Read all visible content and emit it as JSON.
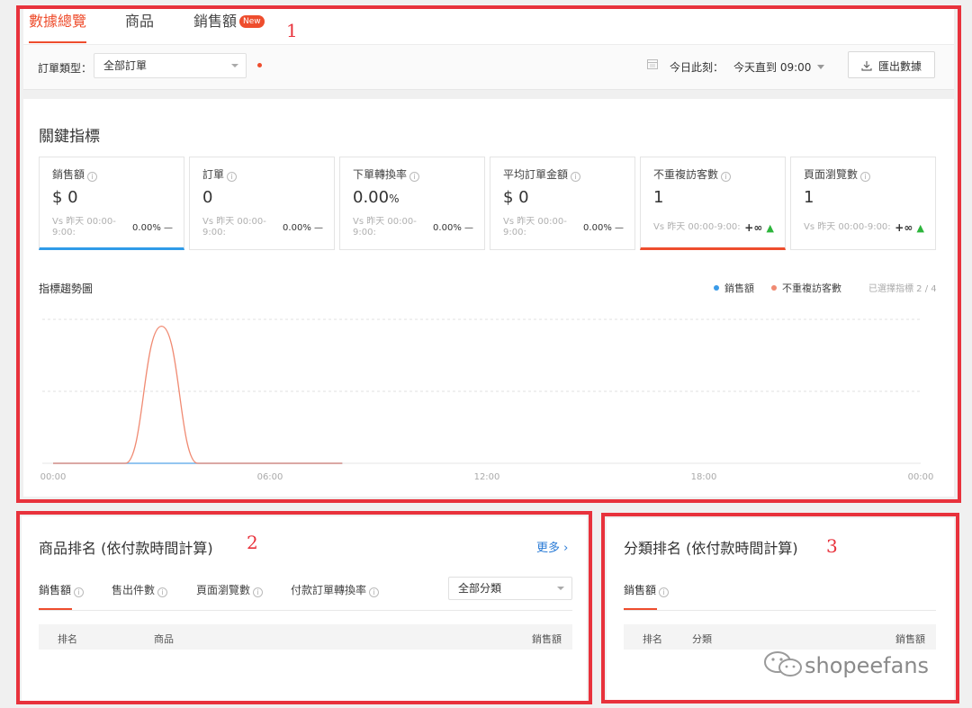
{
  "tabs": [
    {
      "label": "數據總覽",
      "active": true
    },
    {
      "label": "商品",
      "active": false
    },
    {
      "label": "銷售額",
      "active": false,
      "badge": "New"
    }
  ],
  "filters": {
    "order_type_label": "訂單類型：",
    "order_type_value": "全部訂單",
    "date_label": "今日此刻：",
    "date_value": "今天直到 09:00",
    "export_label": "匯出數據"
  },
  "key_metrics": {
    "title": "關鍵指標",
    "cards": [
      {
        "title": "銷售額",
        "value": "$ 0",
        "vs": "Vs 昨天 00:00-9:00:",
        "change": "0.00% —"
      },
      {
        "title": "訂單",
        "value": "0",
        "vs": "Vs 昨天 00:00-9:00:",
        "change": "0.00% —"
      },
      {
        "title": "下單轉換率",
        "value": "0.00",
        "unit": "%",
        "vs": "Vs 昨天 00:00-9:00:",
        "change": "0.00% —"
      },
      {
        "title": "平均訂單金額",
        "value": "$ 0",
        "vs": "Vs 昨天 00:00-9:00:",
        "change": "0.00% —"
      },
      {
        "title": "不重複訪客數",
        "value": "1",
        "vs": "Vs 昨天 00:00-9:00:",
        "change": "+∞"
      },
      {
        "title": "頁面瀏覽數",
        "value": "1",
        "vs": "Vs 昨天 00:00-9:00:",
        "change": "+∞"
      }
    ]
  },
  "trend": {
    "title": "指標趨勢圖",
    "selected_count": "已選擇指標 2 / 4"
  },
  "chart_data": {
    "type": "line",
    "x": [
      "00:00",
      "01:00",
      "02:00",
      "03:00",
      "04:00",
      "05:00",
      "06:00",
      "07:00",
      "08:00"
    ],
    "x_ticks": [
      "00:00",
      "06:00",
      "12:00",
      "18:00",
      "00:00"
    ],
    "series": [
      {
        "name": "銷售額",
        "color": "#3b9be8",
        "values": [
          0,
          0,
          0,
          0,
          0,
          0,
          0,
          0,
          0
        ]
      },
      {
        "name": "不重複訪客數",
        "color": "#f08a72",
        "values": [
          0,
          0,
          0,
          1,
          0,
          0,
          0,
          0,
          0
        ]
      }
    ],
    "ylim": [
      0,
      1.05
    ],
    "grid": true,
    "legend": "top-right"
  },
  "product_rank": {
    "title": "商品排名 (依付款時間計算)",
    "more": "更多",
    "tabs": [
      "銷售額",
      "售出件數",
      "頁面瀏覽數",
      "付款訂單轉換率"
    ],
    "category_select": "全部分類",
    "columns": [
      "排名",
      "商品",
      "銷售額"
    ]
  },
  "category_rank": {
    "title": "分類排名 (依付款時間計算)",
    "tabs": [
      "銷售額"
    ],
    "columns": [
      "排名",
      "分類",
      "銷售額"
    ]
  },
  "annotations": [
    "1",
    "2",
    "3"
  ],
  "watermark": "shopeefans"
}
